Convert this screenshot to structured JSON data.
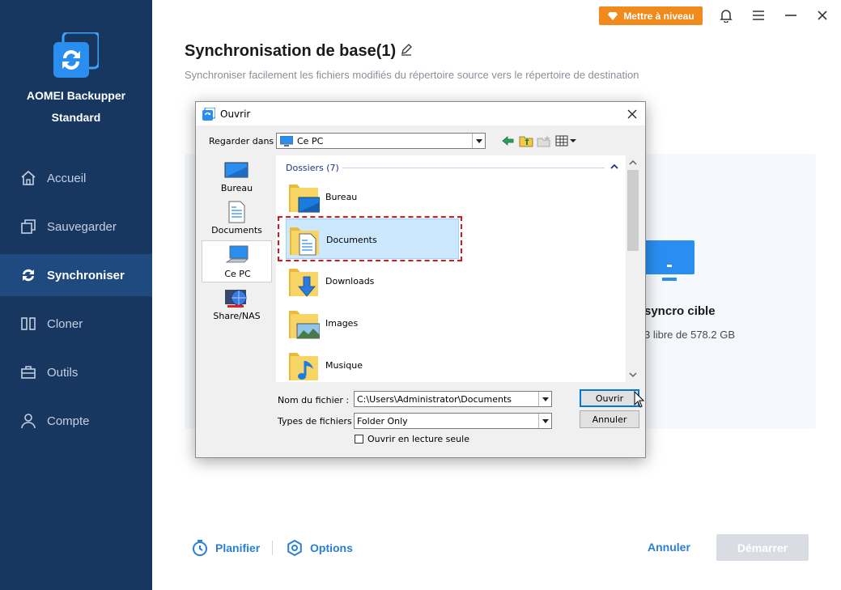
{
  "app": {
    "name": "AOMEI Backupper",
    "edition": "Standard",
    "upgrade_label": "Mettre à niveau"
  },
  "nav": {
    "home": "Accueil",
    "backup": "Sauvegarder",
    "sync": "Synchroniser",
    "clone": "Cloner",
    "tools": "Outils",
    "account": "Compte"
  },
  "page": {
    "title": "Synchronisation de base(1)",
    "subtitle": "Synchroniser facilement les fichiers modifiés du répertoire source vers le répertoire de destination"
  },
  "target": {
    "title": "syncro cible",
    "info": "3 libre de 578.2 GB"
  },
  "footer": {
    "schedule": "Planifier",
    "options": "Options",
    "cancel": "Annuler",
    "start": "Démarrer"
  },
  "dialog": {
    "title": "Ouvrir",
    "look_in_label": "Regarder dans :",
    "look_in_value": "Ce PC",
    "places": {
      "desktop": "Bureau",
      "documents": "Documents",
      "this_pc": "Ce PC",
      "share_nas": "Share/NAS"
    },
    "group_header": "Dossiers (7)",
    "items": {
      "desktop": "Bureau",
      "documents": "Documents",
      "downloads": "Downloads",
      "images": "Images",
      "music": "Musique"
    },
    "filename_label": "Nom du fichier :",
    "filename_value": "C:\\Users\\Administrator\\Documents",
    "filetype_label": "Types de fichiers :",
    "filetype_value": "Folder Only",
    "readonly_label": "Ouvrir en lecture seule",
    "open_button": "Ouvrir",
    "cancel_button": "Annuler"
  },
  "colors": {
    "sidebar": "#173761",
    "sidebar_active": "#1e4a80",
    "accent": "#2a7fd4",
    "upgrade": "#f08a1c",
    "highlight": "#e0121a"
  }
}
